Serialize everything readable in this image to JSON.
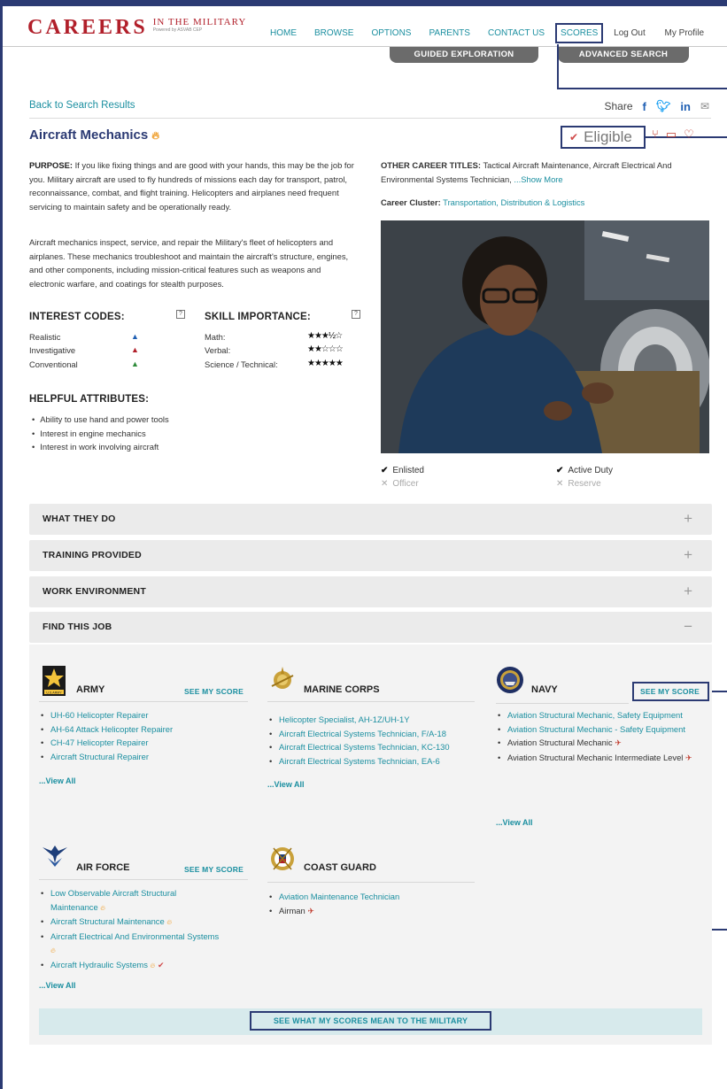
{
  "header": {
    "logo_main": "CAREERS",
    "logo_side": "IN THE MILITARY",
    "logo_powered": "Powered by ASVAB CEP",
    "nav": [
      "HOME",
      "BROWSE",
      "OPTIONS",
      "PARENTS",
      "CONTACT US",
      "SCORES"
    ],
    "logout": "Log Out",
    "profile": "My Profile",
    "tab_guided": "GUIDED EXPLORATION",
    "tab_advanced": "ADVANCED SEARCH"
  },
  "crumb": "Back to Search Results",
  "share_label": "Share",
  "share_icons": [
    "facebook-icon",
    "twitter-icon",
    "linkedin-icon",
    "mail-icon"
  ],
  "title": "Aircraft Mechanics",
  "eligible": "Eligible",
  "purpose": {
    "label": "PURPOSE:",
    "text": " If you like fixing things and are good with your hands, this may be the job for you.  Military aircraft are used to fly hundreds of missions each day for transport, patrol, reconnaissance, combat, and flight training. Helicopters and airplanes need frequent servicing to maintain safety and be operationally ready."
  },
  "description": "Aircraft mechanics inspect, service, and repair the Military's fleet of helicopters and airplanes. These mechanics troubleshoot and maintain the aircraft's structure, engines, and other components, including mission-critical features such as weapons and electronic warfare, and coatings for stealth purposes.",
  "other_titles": {
    "label": "OTHER CAREER TITLES:",
    "text": " Tactical Aircraft Maintenance, Aircraft Electrical And Environmental Systems Technician,",
    "more": " ...Show More"
  },
  "cluster": {
    "label": "Career Cluster:",
    "link": " Transportation, Distribution & Logistics"
  },
  "services": {
    "enlisted": "Enlisted",
    "officer": "Officer",
    "active": "Active Duty",
    "reserve": "Reserve"
  },
  "interest": {
    "heading": "INTEREST CODES:",
    "qmark": "?",
    "codes": [
      {
        "label": "Realistic",
        "color": "#1f5fb3"
      },
      {
        "label": "Investigative",
        "color": "#b11f2a"
      },
      {
        "label": "Conventional",
        "color": "#2e8b3a"
      }
    ]
  },
  "skills": {
    "heading": "SKILL IMPORTANCE:",
    "qmark": "?",
    "rows": [
      {
        "label": "Math:",
        "stars": "★★★½☆",
        "rating": 3.5
      },
      {
        "label": "Verbal:",
        "stars": "★★☆☆☆",
        "rating": 2
      },
      {
        "label": "Science / Technical:",
        "stars": "★★★★★",
        "rating": 5
      }
    ]
  },
  "helpful": {
    "heading": "HELPFUL ATTRIBUTES:",
    "items": [
      "Ability to use hand and power tools",
      "Interest in engine mechanics",
      "Interest in work involving aircraft"
    ]
  },
  "accordion": [
    "WHAT THEY DO",
    "TRAINING PROVIDED",
    "WORK ENVIRONMENT",
    "FIND THIS JOB"
  ],
  "accordion_icons": [
    "+",
    "+",
    "+",
    "−"
  ],
  "see_my_score": "SEE MY SCORE",
  "view_all": "...View All",
  "army": {
    "name": "ARMY",
    "emblem_text": "U.S.ARMY",
    "jobs": [
      "UH-60 Helicopter Repairer",
      "AH-64 Attack Helicopter Repairer",
      "CH-47 Helicopter Repairer",
      "Aircraft Structural Repairer"
    ]
  },
  "marines": {
    "name": "MARINE CORPS",
    "jobs": [
      "Helicopter Specialist, AH-1Z/UH-1Y",
      "Aircraft Electrical Systems Technician, F/A-18",
      "Aircraft Electrical Systems Technician, KC-130",
      "Aircraft Electrical Systems Technician, EA-6"
    ]
  },
  "navy": {
    "name": "NAVY",
    "jobs": [
      "Aviation Structural Mechanic, Safety Equipment",
      "Aviation Structural Mechanic - Safety Equipment",
      "Aviation Structural Mechanic",
      "Aviation Structural Mechanic Intermediate Level"
    ]
  },
  "airforce": {
    "name": "AIR FORCE",
    "jobs": [
      "Low Observable Aircraft Structural Maintenance",
      "Aircraft Structural Maintenance",
      "Aircraft Electrical And Environmental Systems",
      "Aircraft Hydraulic Systems"
    ]
  },
  "coastguard": {
    "name": "COAST GUARD",
    "jobs": [
      "Aviation Maintenance Technician",
      "Airman"
    ]
  },
  "bottom_cta": "SEE WHAT MY SCORES MEAN TO THE MILITARY"
}
